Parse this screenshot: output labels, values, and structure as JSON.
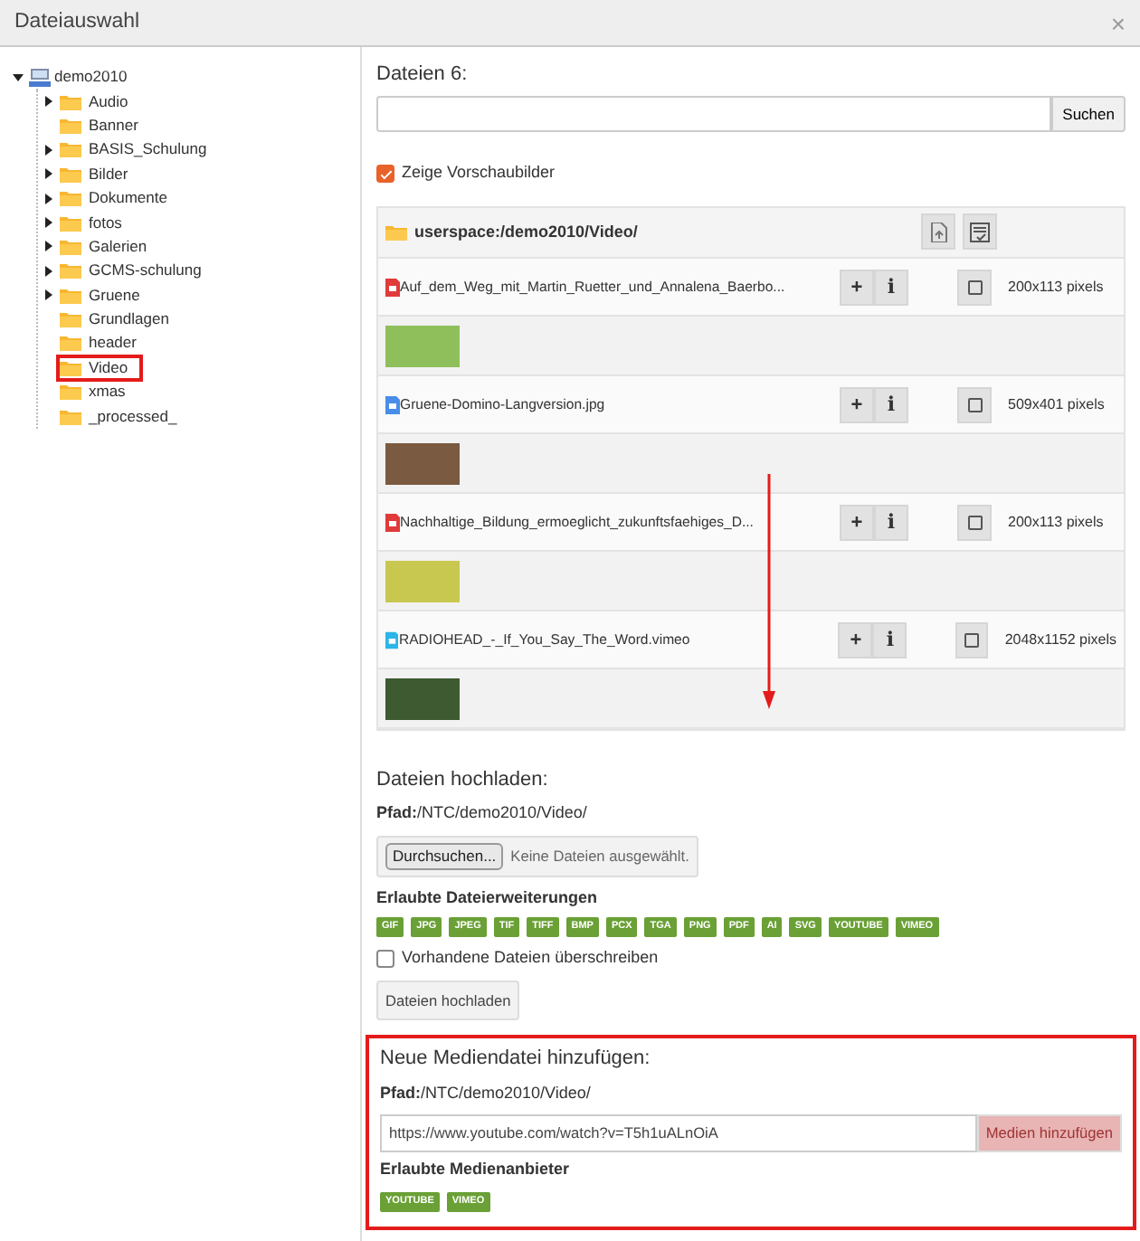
{
  "window": {
    "title": "Dateiauswahl",
    "close": "×"
  },
  "tree": {
    "label": "demo2010",
    "expanded": true,
    "children": [
      {
        "label": "Audio",
        "has_children": true,
        "selected": false
      },
      {
        "label": "Banner",
        "has_children": false,
        "selected": false
      },
      {
        "label": "BASIS_Schulung",
        "has_children": true,
        "selected": false
      },
      {
        "label": "Bilder",
        "has_children": true,
        "selected": false
      },
      {
        "label": "Dokumente",
        "has_children": true,
        "selected": false
      },
      {
        "label": "fotos",
        "has_children": true,
        "selected": false
      },
      {
        "label": "Galerien",
        "has_children": true,
        "selected": false
      },
      {
        "label": "GCMS-schulung",
        "has_children": true,
        "selected": false
      },
      {
        "label": "Gruene",
        "has_children": true,
        "selected": false
      },
      {
        "label": "Grundlagen",
        "has_children": false,
        "selected": false
      },
      {
        "label": "header",
        "has_children": false,
        "selected": false
      },
      {
        "label": "Video",
        "has_children": false,
        "selected": true
      },
      {
        "label": "xmas",
        "has_children": false,
        "selected": false
      },
      {
        "label": "_processed_",
        "has_children": false,
        "selected": false
      }
    ]
  },
  "files_heading": "Dateien 6:",
  "search": {
    "button": "Suchen"
  },
  "preview_toggle": {
    "label": "Zeige Vorschaubilder",
    "checked": true
  },
  "file_table": {
    "path": "userspace:/demo2010/Video/",
    "rows": [
      {
        "kind": "video",
        "name": "Auf_dem_Weg_mit_Martin_Ruetter_und_Annalena_Baerbo...",
        "add": "+",
        "info": "i",
        "size": "200x113 pixels",
        "checked": false
      },
      {
        "kind": "image",
        "name": "Gruene-Domino-Langversion.jpg",
        "add": "+",
        "info": "i",
        "size": "509x401 pixels",
        "checked": false
      },
      {
        "kind": "video",
        "name": "Nachhaltige_Bildung_ermoeglicht_zukunftsfaehiges_D...",
        "add": "+",
        "info": "i",
        "size": "200x113 pixels",
        "checked": false
      },
      {
        "kind": "vimeo",
        "name": "RADIOHEAD_-_If_You_Say_The_Word.vimeo",
        "add": "+",
        "info": "i",
        "size": "2048x1152 pixels",
        "checked": false
      }
    ]
  },
  "upload": {
    "heading": "Dateien hochladen:",
    "path_label": "Pfad:",
    "path": "/NTC/demo2010/Video/",
    "browse": "Durchsuchen...",
    "no_file": "Keine Dateien ausgewählt.",
    "ext_heading": "Erlaubte Dateierweiterungen",
    "extensions": [
      "GIF",
      "JPG",
      "JPEG",
      "TIF",
      "TIFF",
      "BMP",
      "PCX",
      "TGA",
      "PNG",
      "PDF",
      "AI",
      "SVG",
      "YOUTUBE",
      "VIMEO"
    ],
    "overwrite": {
      "label": "Vorhandene Dateien überschreiben",
      "checked": false
    },
    "button": "Dateien hochladen"
  },
  "media": {
    "highlighted": true,
    "heading": "Neue Mediendatei hinzufügen:",
    "path_label": "Pfad:",
    "path": "/NTC/demo2010/Video/",
    "url": "https://www.youtube.com/watch?v=T5h1uALnOiA",
    "button": "Medien hinzufügen",
    "providers_heading": "Erlaubte Medienanbieter",
    "providers": [
      "YOUTUBE",
      "VIMEO"
    ]
  }
}
